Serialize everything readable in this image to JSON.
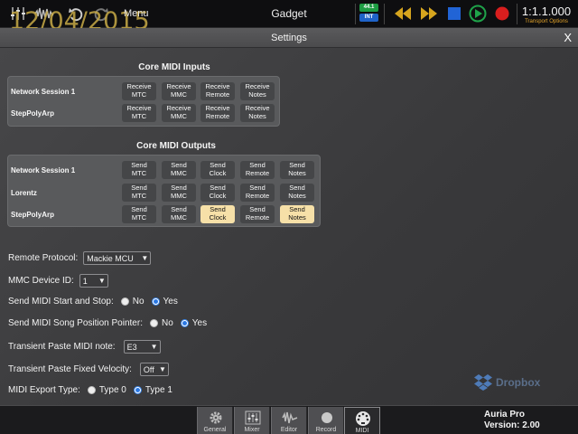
{
  "watermark_date": "12/04/2015",
  "topbar": {
    "menu_label": "Menu",
    "title": "Gadget",
    "sample_rate": "44.1",
    "sync_mode": "INT",
    "timecode": "1:1.1.000",
    "transport_options": "Transport Options",
    "icons": [
      "mixer-meter-icon",
      "waveform-icon",
      "undo-icon",
      "redo-icon",
      "rewind-icon",
      "fast-forward-icon",
      "stop-icon",
      "play-icon",
      "record-icon"
    ],
    "colors": {
      "transport_gold": "#d6a51e",
      "stop_blue": "#2164d6",
      "play_green": "#1fa34a",
      "record_red": "#d91e1e"
    }
  },
  "settings": {
    "title": "Settings",
    "close_label": "X"
  },
  "core_midi_inputs": {
    "title": "Core MIDI Inputs",
    "rows": [
      {
        "label": "Network Session 1",
        "buttons": [
          {
            "text": "Receive\nMTC",
            "active": false
          },
          {
            "text": "Receive\nMMC",
            "active": false
          },
          {
            "text": "Receive\nRemote",
            "active": false
          },
          {
            "text": "Receive\nNotes",
            "active": false
          }
        ]
      },
      {
        "label": "StepPolyArp",
        "buttons": [
          {
            "text": "Receive\nMTC",
            "active": false
          },
          {
            "text": "Receive\nMMC",
            "active": false
          },
          {
            "text": "Receive\nRemote",
            "active": false
          },
          {
            "text": "Receive\nNotes",
            "active": false
          }
        ]
      }
    ]
  },
  "core_midi_outputs": {
    "title": "Core MIDI Outputs",
    "rows": [
      {
        "label": "Network Session 1",
        "buttons": [
          {
            "text": "Send\nMTC",
            "active": false
          },
          {
            "text": "Send\nMMC",
            "active": false
          },
          {
            "text": "Send\nClock",
            "active": false
          },
          {
            "text": "Send\nRemote",
            "active": false
          },
          {
            "text": "Send\nNotes",
            "active": false
          }
        ]
      },
      {
        "label": "Lorentz",
        "buttons": [
          {
            "text": "Send\nMTC",
            "active": false
          },
          {
            "text": "Send\nMMC",
            "active": false
          },
          {
            "text": "Send\nClock",
            "active": false
          },
          {
            "text": "Send\nRemote",
            "active": false
          },
          {
            "text": "Send\nNotes",
            "active": false
          }
        ]
      },
      {
        "label": "StepPolyArp",
        "buttons": [
          {
            "text": "Send\nMTC",
            "active": false
          },
          {
            "text": "Send\nMMC",
            "active": false
          },
          {
            "text": "Send\nClock",
            "active": true
          },
          {
            "text": "Send\nRemote",
            "active": false
          },
          {
            "text": "Send\nNotes",
            "active": true
          }
        ]
      }
    ]
  },
  "form": {
    "remote_protocol": {
      "label": "Remote Protocol:",
      "value": "Mackie MCU"
    },
    "mmc_device_id": {
      "label": "MMC Device ID:",
      "value": "1"
    },
    "send_start_stop": {
      "label": "Send MIDI Start and Stop:",
      "no": "No",
      "yes": "Yes",
      "selected": "Yes"
    },
    "send_song_position": {
      "label": "Send MIDI Song Position Pointer:",
      "no": "No",
      "yes": "Yes",
      "selected": "Yes"
    },
    "transient_paste_note": {
      "label": "Transient Paste MIDI note:",
      "value": "E3"
    },
    "transient_paste_velocity": {
      "label": "Transient Paste Fixed Velocity:",
      "value": "Off"
    },
    "midi_export_type": {
      "label": "MIDI Export Type:",
      "type0": "Type 0",
      "type1": "Type 1",
      "selected": "Type 1"
    }
  },
  "dropbox_label": "Dropbox",
  "bottom_tabs": [
    {
      "label": "General",
      "icon": "gear-icon",
      "active": false
    },
    {
      "label": "Mixer",
      "icon": "mixer-icon",
      "active": false
    },
    {
      "label": "Editor",
      "icon": "editor-icon",
      "active": false
    },
    {
      "label": "Record",
      "icon": "record-circle-icon",
      "active": false
    },
    {
      "label": "MIDI",
      "icon": "midi-icon",
      "active": true
    }
  ],
  "version": {
    "product": "Auria Pro",
    "version": "Version: 2.00"
  }
}
